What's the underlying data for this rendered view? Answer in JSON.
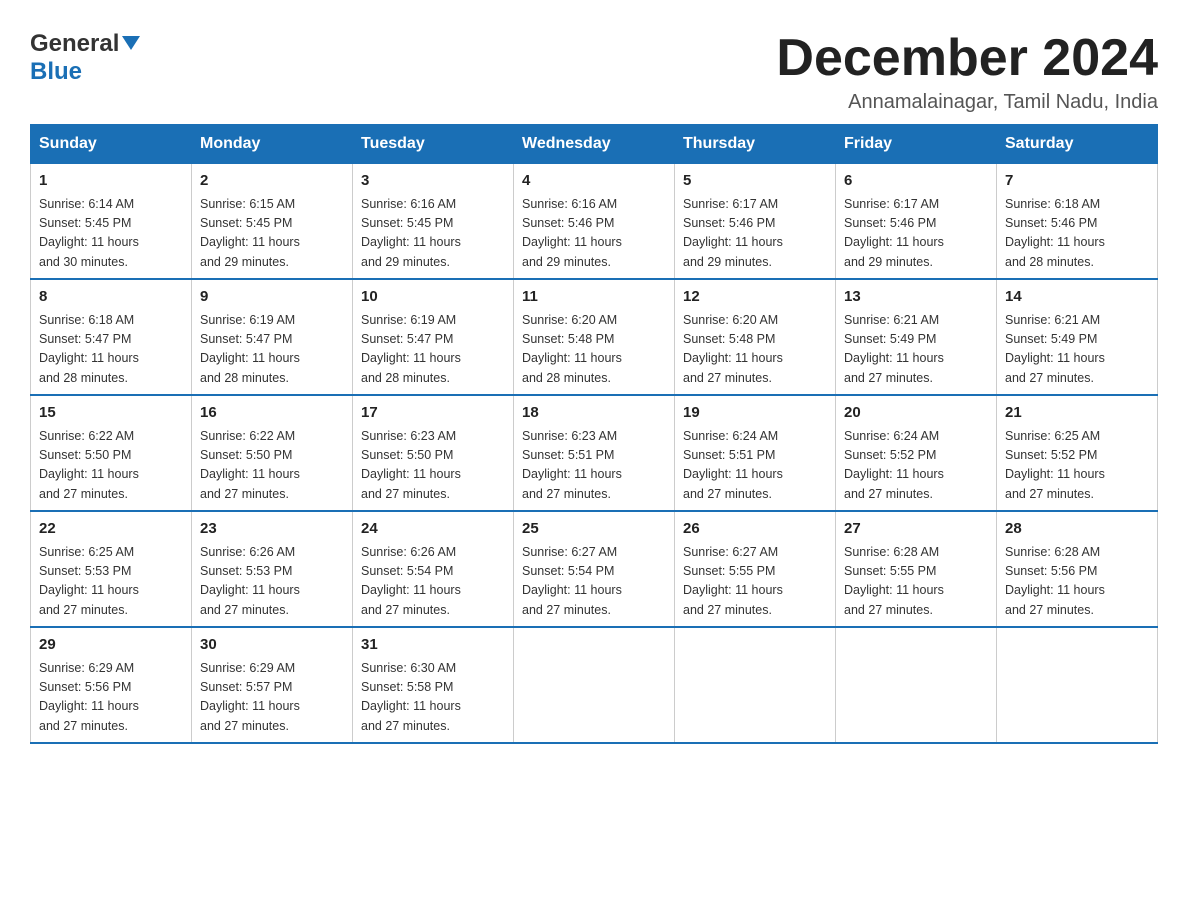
{
  "logo": {
    "general": "General",
    "blue": "Blue"
  },
  "header": {
    "title": "December 2024",
    "subtitle": "Annamalainagar, Tamil Nadu, India"
  },
  "days": [
    "Sunday",
    "Monday",
    "Tuesday",
    "Wednesday",
    "Thursday",
    "Friday",
    "Saturday"
  ],
  "weeks": [
    [
      {
        "day": "1",
        "sunrise": "6:14 AM",
        "sunset": "5:45 PM",
        "daylight": "11 hours and 30 minutes."
      },
      {
        "day": "2",
        "sunrise": "6:15 AM",
        "sunset": "5:45 PM",
        "daylight": "11 hours and 29 minutes."
      },
      {
        "day": "3",
        "sunrise": "6:16 AM",
        "sunset": "5:45 PM",
        "daylight": "11 hours and 29 minutes."
      },
      {
        "day": "4",
        "sunrise": "6:16 AM",
        "sunset": "5:46 PM",
        "daylight": "11 hours and 29 minutes."
      },
      {
        "day": "5",
        "sunrise": "6:17 AM",
        "sunset": "5:46 PM",
        "daylight": "11 hours and 29 minutes."
      },
      {
        "day": "6",
        "sunrise": "6:17 AM",
        "sunset": "5:46 PM",
        "daylight": "11 hours and 29 minutes."
      },
      {
        "day": "7",
        "sunrise": "6:18 AM",
        "sunset": "5:46 PM",
        "daylight": "11 hours and 28 minutes."
      }
    ],
    [
      {
        "day": "8",
        "sunrise": "6:18 AM",
        "sunset": "5:47 PM",
        "daylight": "11 hours and 28 minutes."
      },
      {
        "day": "9",
        "sunrise": "6:19 AM",
        "sunset": "5:47 PM",
        "daylight": "11 hours and 28 minutes."
      },
      {
        "day": "10",
        "sunrise": "6:19 AM",
        "sunset": "5:47 PM",
        "daylight": "11 hours and 28 minutes."
      },
      {
        "day": "11",
        "sunrise": "6:20 AM",
        "sunset": "5:48 PM",
        "daylight": "11 hours and 28 minutes."
      },
      {
        "day": "12",
        "sunrise": "6:20 AM",
        "sunset": "5:48 PM",
        "daylight": "11 hours and 27 minutes."
      },
      {
        "day": "13",
        "sunrise": "6:21 AM",
        "sunset": "5:49 PM",
        "daylight": "11 hours and 27 minutes."
      },
      {
        "day": "14",
        "sunrise": "6:21 AM",
        "sunset": "5:49 PM",
        "daylight": "11 hours and 27 minutes."
      }
    ],
    [
      {
        "day": "15",
        "sunrise": "6:22 AM",
        "sunset": "5:50 PM",
        "daylight": "11 hours and 27 minutes."
      },
      {
        "day": "16",
        "sunrise": "6:22 AM",
        "sunset": "5:50 PM",
        "daylight": "11 hours and 27 minutes."
      },
      {
        "day": "17",
        "sunrise": "6:23 AM",
        "sunset": "5:50 PM",
        "daylight": "11 hours and 27 minutes."
      },
      {
        "day": "18",
        "sunrise": "6:23 AM",
        "sunset": "5:51 PM",
        "daylight": "11 hours and 27 minutes."
      },
      {
        "day": "19",
        "sunrise": "6:24 AM",
        "sunset": "5:51 PM",
        "daylight": "11 hours and 27 minutes."
      },
      {
        "day": "20",
        "sunrise": "6:24 AM",
        "sunset": "5:52 PM",
        "daylight": "11 hours and 27 minutes."
      },
      {
        "day": "21",
        "sunrise": "6:25 AM",
        "sunset": "5:52 PM",
        "daylight": "11 hours and 27 minutes."
      }
    ],
    [
      {
        "day": "22",
        "sunrise": "6:25 AM",
        "sunset": "5:53 PM",
        "daylight": "11 hours and 27 minutes."
      },
      {
        "day": "23",
        "sunrise": "6:26 AM",
        "sunset": "5:53 PM",
        "daylight": "11 hours and 27 minutes."
      },
      {
        "day": "24",
        "sunrise": "6:26 AM",
        "sunset": "5:54 PM",
        "daylight": "11 hours and 27 minutes."
      },
      {
        "day": "25",
        "sunrise": "6:27 AM",
        "sunset": "5:54 PM",
        "daylight": "11 hours and 27 minutes."
      },
      {
        "day": "26",
        "sunrise": "6:27 AM",
        "sunset": "5:55 PM",
        "daylight": "11 hours and 27 minutes."
      },
      {
        "day": "27",
        "sunrise": "6:28 AM",
        "sunset": "5:55 PM",
        "daylight": "11 hours and 27 minutes."
      },
      {
        "day": "28",
        "sunrise": "6:28 AM",
        "sunset": "5:56 PM",
        "daylight": "11 hours and 27 minutes."
      }
    ],
    [
      {
        "day": "29",
        "sunrise": "6:29 AM",
        "sunset": "5:56 PM",
        "daylight": "11 hours and 27 minutes."
      },
      {
        "day": "30",
        "sunrise": "6:29 AM",
        "sunset": "5:57 PM",
        "daylight": "11 hours and 27 minutes."
      },
      {
        "day": "31",
        "sunrise": "6:30 AM",
        "sunset": "5:58 PM",
        "daylight": "11 hours and 27 minutes."
      },
      null,
      null,
      null,
      null
    ]
  ],
  "labels": {
    "sunrise": "Sunrise:",
    "sunset": "Sunset:",
    "daylight": "Daylight:"
  }
}
